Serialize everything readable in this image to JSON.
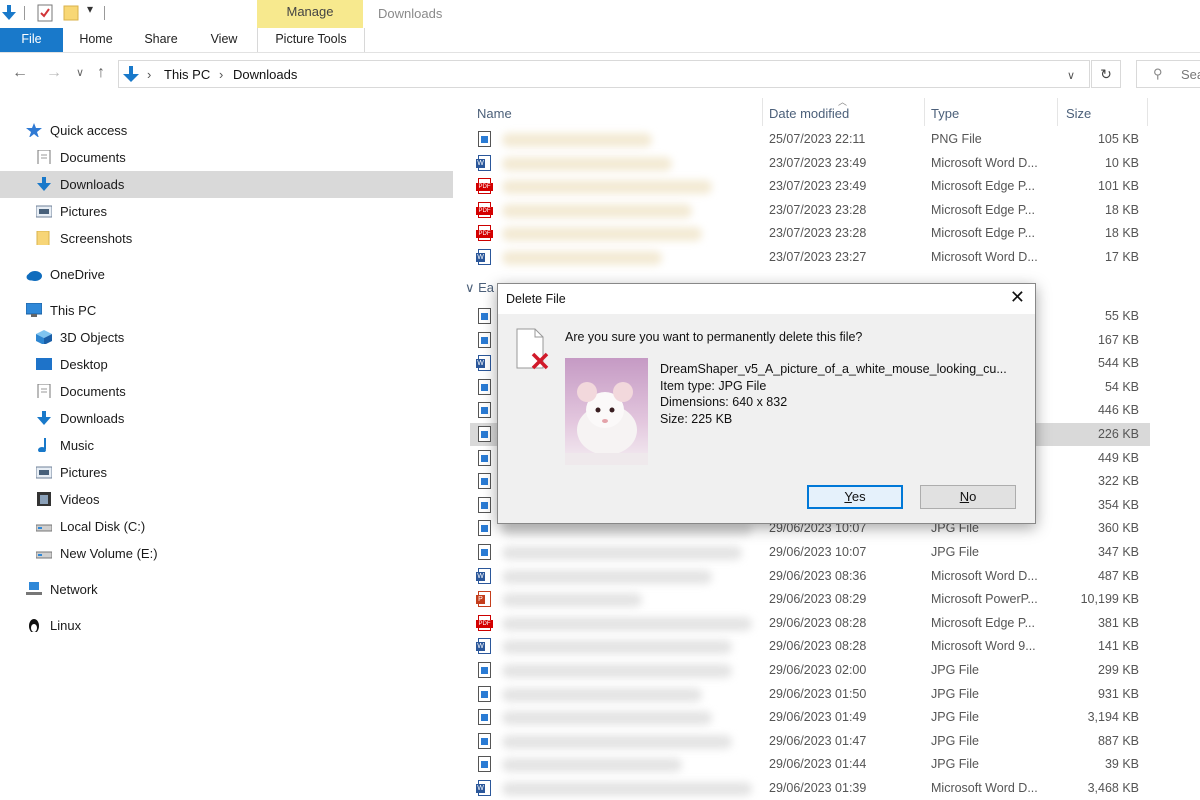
{
  "ribbon": {
    "manage_label": "Manage",
    "window_title": "Downloads",
    "tabs": [
      "File",
      "Home",
      "Share",
      "View",
      "Picture Tools"
    ]
  },
  "address": {
    "crumbs": [
      "This PC",
      "Downloads"
    ],
    "search_placeholder": "Sea"
  },
  "nav": {
    "items": [
      {
        "label": "Quick access",
        "icon": "star-icon"
      },
      {
        "label": "Documents",
        "icon": "document-icon"
      },
      {
        "label": "Downloads",
        "icon": "download-arrow-icon"
      },
      {
        "label": "Pictures",
        "icon": "pictures-icon"
      },
      {
        "label": "Screenshots",
        "icon": "folder-icon"
      },
      {
        "label": "OneDrive",
        "icon": "cloud-icon"
      },
      {
        "label": "This PC",
        "icon": "computer-icon"
      },
      {
        "label": "3D Objects",
        "icon": "cube-icon"
      },
      {
        "label": "Desktop",
        "icon": "desktop-icon"
      },
      {
        "label": "Documents",
        "icon": "document-icon"
      },
      {
        "label": "Downloads",
        "icon": "download-arrow-icon"
      },
      {
        "label": "Music",
        "icon": "music-note-icon"
      },
      {
        "label": "Pictures",
        "icon": "pictures-icon"
      },
      {
        "label": "Videos",
        "icon": "film-icon"
      },
      {
        "label": "Local Disk (C:)",
        "icon": "drive-icon"
      },
      {
        "label": "New Volume (E:)",
        "icon": "drive-icon"
      },
      {
        "label": "Network",
        "icon": "network-icon"
      },
      {
        "label": "Linux",
        "icon": "penguin-icon"
      }
    ]
  },
  "columns": {
    "name": "Name",
    "date": "Date modified",
    "type": "Type",
    "size": "Size"
  },
  "group_label": "Ea",
  "files": [
    {
      "icon": "img",
      "date": "25/07/2023 22:11",
      "type": "PNG File",
      "size": "105 KB"
    },
    {
      "icon": "word",
      "date": "23/07/2023 23:49",
      "type": "Microsoft Word D...",
      "size": "10 KB"
    },
    {
      "icon": "pdf",
      "date": "23/07/2023 23:49",
      "type": "Microsoft Edge P...",
      "size": "101 KB"
    },
    {
      "icon": "pdf",
      "date": "23/07/2023 23:28",
      "type": "Microsoft Edge P...",
      "size": "18 KB"
    },
    {
      "icon": "pdf",
      "date": "23/07/2023 23:28",
      "type": "Microsoft Edge P...",
      "size": "18 KB"
    },
    {
      "icon": "word",
      "date": "23/07/2023 23:27",
      "type": "Microsoft Word D...",
      "size": "17 KB"
    },
    {
      "icon": "img",
      "date": "",
      "type": "",
      "size": "55 KB"
    },
    {
      "icon": "img",
      "date": "",
      "type": "",
      "size": "167 KB"
    },
    {
      "icon": "word",
      "date": "",
      "type": "",
      "size": "544 KB"
    },
    {
      "icon": "img",
      "date": "",
      "type": "",
      "size": "54 KB"
    },
    {
      "icon": "img",
      "date": "",
      "type": "",
      "size": "446 KB"
    },
    {
      "icon": "img",
      "date": "",
      "type": "",
      "size": "226 KB"
    },
    {
      "icon": "img",
      "date": "",
      "type": "",
      "size": "449 KB"
    },
    {
      "icon": "img",
      "date": "",
      "type": "",
      "size": "322 KB"
    },
    {
      "icon": "img",
      "date": "",
      "type": "",
      "size": "354 KB"
    },
    {
      "icon": "img",
      "date": "29/06/2023 10:07",
      "type": "JPG File",
      "size": "360 KB"
    },
    {
      "icon": "img",
      "date": "29/06/2023 10:07",
      "type": "JPG File",
      "size": "347 KB"
    },
    {
      "icon": "word",
      "date": "29/06/2023 08:36",
      "type": "Microsoft Word D...",
      "size": "487 KB"
    },
    {
      "icon": "ppt",
      "date": "29/06/2023 08:29",
      "type": "Microsoft PowerP...",
      "size": "10,199 KB"
    },
    {
      "icon": "pdf",
      "date": "29/06/2023 08:28",
      "type": "Microsoft Edge P...",
      "size": "381 KB"
    },
    {
      "icon": "word",
      "date": "29/06/2023 08:28",
      "type": "Microsoft Word 9...",
      "size": "141 KB"
    },
    {
      "icon": "img",
      "date": "29/06/2023 02:00",
      "type": "JPG File",
      "size": "299 KB"
    },
    {
      "icon": "img",
      "date": "29/06/2023 01:50",
      "type": "JPG File",
      "size": "931 KB"
    },
    {
      "icon": "img",
      "date": "29/06/2023 01:49",
      "type": "JPG File",
      "size": "3,194 KB"
    },
    {
      "icon": "img",
      "date": "29/06/2023 01:47",
      "type": "JPG File",
      "size": "887 KB"
    },
    {
      "icon": "img",
      "date": "29/06/2023 01:44",
      "type": "JPG File",
      "size": "39 KB"
    },
    {
      "icon": "word",
      "date": "29/06/2023 01:39",
      "type": "Microsoft Word D...",
      "size": "3,468 KB"
    }
  ],
  "dialog": {
    "title": "Delete File",
    "question": "Are you sure you want to permanently delete this file?",
    "file_name": "DreamShaper_v5_A_picture_of_a_white_mouse_looking_cu...",
    "item_type": "Item type: JPG File",
    "dimensions": "Dimensions: 640 x 832",
    "size": "Size: 225 KB",
    "yes_label": "es",
    "yes_key": "Y",
    "no_label": "o",
    "no_key": "N"
  }
}
